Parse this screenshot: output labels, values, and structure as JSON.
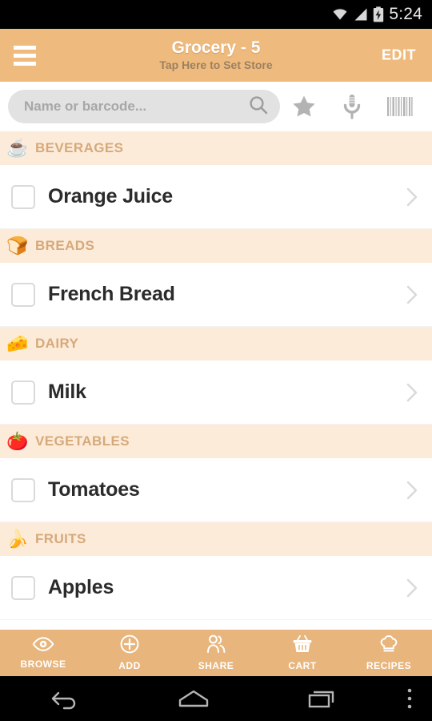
{
  "statusbar": {
    "time": "5:24",
    "icons": [
      "wifi-icon",
      "cell-signal-icon",
      "battery-charging-icon"
    ]
  },
  "appbar": {
    "menu_icon": "hamburger-menu-icon",
    "title": "Grocery - 5",
    "subtitle": "Tap Here to Set Store",
    "edit_label": "EDIT",
    "background": "#efba7d"
  },
  "search": {
    "placeholder": "Name or barcode...",
    "value": "",
    "search_icon": "search-icon",
    "actions": [
      {
        "name": "favorites-star-icon",
        "label": "star"
      },
      {
        "name": "voice-input-icon",
        "label": "microphone"
      },
      {
        "name": "barcode-scan-icon",
        "label": "barcode"
      }
    ]
  },
  "list": {
    "sections": [
      {
        "category": "BEVERAGES",
        "emoji": "☕",
        "icon_name": "coffee-cup-icon",
        "items": [
          {
            "label": "Orange Juice",
            "checked": false
          }
        ]
      },
      {
        "category": "BREADS",
        "emoji": "🍞",
        "icon_name": "bread-slice-icon",
        "items": [
          {
            "label": "French Bread",
            "checked": false
          }
        ]
      },
      {
        "category": "DAIRY",
        "emoji": "🧀",
        "icon_name": "cheese-wedge-icon",
        "items": [
          {
            "label": "Milk",
            "checked": false
          }
        ]
      },
      {
        "category": "VEGETABLES",
        "emoji": "🍅",
        "icon_name": "tomato-icon",
        "items": [
          {
            "label": "Tomatoes",
            "checked": false
          }
        ]
      },
      {
        "category": "FRUITS",
        "emoji": "🍌",
        "icon_name": "banana-icon",
        "items": [
          {
            "label": "Apples",
            "checked": false
          }
        ]
      }
    ]
  },
  "bottomnav": {
    "background": "#e8b57c",
    "items": [
      {
        "label": "BROWSE",
        "icon_name": "eye-icon"
      },
      {
        "label": "ADD",
        "icon_name": "plus-circle-icon"
      },
      {
        "label": "SHARE",
        "icon_name": "people-icon"
      },
      {
        "label": "CART",
        "icon_name": "shopping-basket-icon"
      },
      {
        "label": "RECIPES",
        "icon_name": "chef-hat-icon"
      }
    ]
  },
  "androidnav": {
    "items": [
      {
        "icon_name": "back-icon"
      },
      {
        "icon_name": "home-icon"
      },
      {
        "icon_name": "recents-icon"
      },
      {
        "icon_name": "overflow-menu-icon"
      }
    ]
  },
  "colors": {
    "accent": "#efba7d",
    "category_bg": "#fdebda",
    "category_text": "#d5a97a",
    "item_text": "#2b2b2b"
  }
}
